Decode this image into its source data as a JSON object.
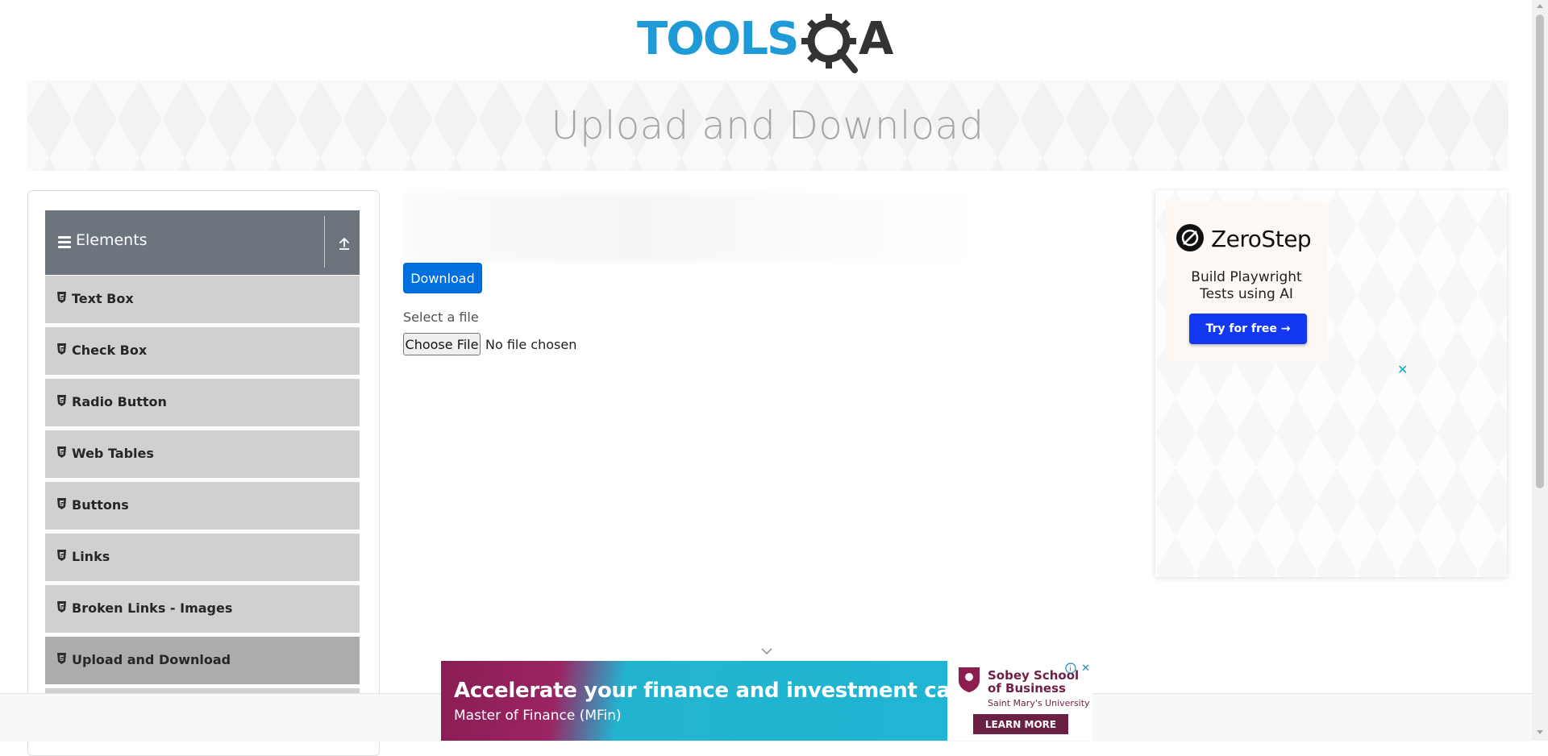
{
  "logo": {
    "text": "TOOLSQA",
    "colors": {
      "primary": "#1e9ad6",
      "dark": "#333333"
    }
  },
  "banner": {
    "title": "Upload and Download"
  },
  "sidebar": {
    "group": {
      "title": "Elements",
      "icon": "upload-icon"
    },
    "items": [
      {
        "label": "Text Box"
      },
      {
        "label": "Check Box"
      },
      {
        "label": "Radio Button"
      },
      {
        "label": "Web Tables"
      },
      {
        "label": "Buttons"
      },
      {
        "label": "Links"
      },
      {
        "label": "Broken Links - Images"
      },
      {
        "label": "Upload and Download",
        "active": true
      }
    ]
  },
  "main": {
    "download_label": "Download",
    "select_label": "Select a file",
    "choose_file_label": "Choose File",
    "no_file_text": "No file chosen",
    "accent": "#0070e0"
  },
  "right_ad": {
    "brand": "ZeroStep",
    "tagline": "Build Playwright Tests using AI",
    "cta": "Try for free →",
    "close": "✕",
    "cta_color": "#1338f2"
  },
  "bottom_ad": {
    "headline": "Accelerate your finance and investment career.",
    "subheadline": "Master of Finance (MFin)",
    "school": "Sobey School of Business",
    "university": "Saint Mary's University",
    "cta": "LEARN MORE",
    "close": "✕"
  }
}
